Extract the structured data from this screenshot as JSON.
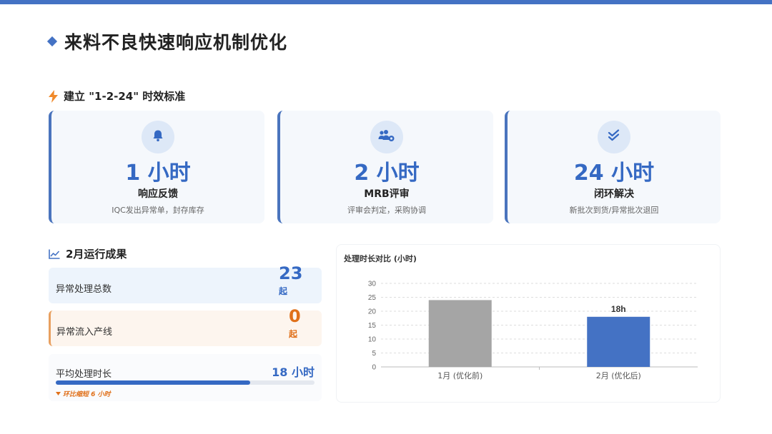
{
  "title": "来料不良快速响应机制优化",
  "section1": {
    "title": "建立 \"1-2-24\" 时效标准",
    "icon": "lightning-icon"
  },
  "cards": [
    {
      "icon": "bell-icon",
      "value": "1 小时",
      "name": "响应反馈",
      "desc": "IQC发出异常单，封存库存"
    },
    {
      "icon": "users-gear-icon",
      "value": "2 小时",
      "name": "MRB评审",
      "desc": "评审会判定，采购协调"
    },
    {
      "icon": "double-check-icon",
      "value": "24 小时",
      "name": "闭环解决",
      "desc": "新批次到货/异常批次退回"
    }
  ],
  "section2": {
    "title": "2月运行成果",
    "icon": "line-chart-icon"
  },
  "stats": {
    "total": {
      "label": "异常处理总数",
      "value": "23",
      "unit": "起"
    },
    "inflow": {
      "label": "异常流入产线",
      "value": "0",
      "unit": "起"
    },
    "avg": {
      "label": "平均处理时长",
      "value": "18 小时",
      "progress": 0.75,
      "note": "环比缩短 6 小时"
    }
  },
  "colors": {
    "primary": "#4472c4",
    "accent": "#3569c3",
    "orange": "#e0701a",
    "gray_bar": "#a5a5a5"
  },
  "chart_data": {
    "type": "bar",
    "title": "处理时长对比 (小时)",
    "categories": [
      "1月 (优化前)",
      "2月 (优化后)"
    ],
    "values": [
      24,
      18
    ],
    "data_labels": [
      "",
      "18h"
    ],
    "bar_colors": [
      "#a5a5a5",
      "#4472c4"
    ],
    "ylim": [
      0,
      30
    ],
    "yticks": [
      0,
      5,
      10,
      15,
      20,
      25,
      30
    ],
    "grid": true,
    "xlabel": "",
    "ylabel": ""
  }
}
